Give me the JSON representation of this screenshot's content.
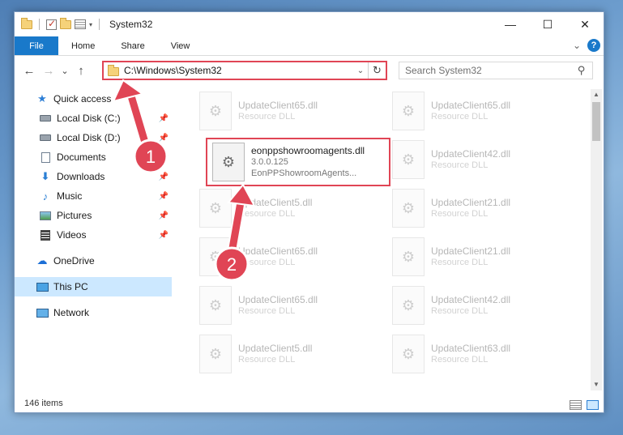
{
  "window": {
    "title": "System32",
    "controls": {
      "minimize": "—",
      "maximize": "☐",
      "close": "✕"
    }
  },
  "ribbon": {
    "tabs": [
      "File",
      "Home",
      "Share",
      "View"
    ],
    "expand": "⌄",
    "help": "?"
  },
  "nav": {
    "back": "←",
    "forward": "→",
    "recent": "⌄",
    "up": "↑",
    "address": "C:\\Windows\\System32",
    "address_dropdown": "⌄",
    "refresh": "↻",
    "search_placeholder": "Search System32",
    "search_icon": "⚲"
  },
  "sidebar": {
    "pin": "📌",
    "items": [
      {
        "label": "Quick access",
        "icon": "star-icon"
      },
      {
        "label": "Local Disk (C:)",
        "icon": "drive-icon",
        "pinned": true
      },
      {
        "label": "Local Disk (D:)",
        "icon": "drive-icon",
        "pinned": true
      },
      {
        "label": "Documents",
        "icon": "document-icon",
        "pinned": true
      },
      {
        "label": "Downloads",
        "icon": "download-icon",
        "pinned": true
      },
      {
        "label": "Music",
        "icon": "music-icon",
        "pinned": true
      },
      {
        "label": "Pictures",
        "icon": "pictures-icon",
        "pinned": true
      },
      {
        "label": "Videos",
        "icon": "videos-icon",
        "pinned": true
      },
      {
        "label": "OneDrive",
        "icon": "cloud-icon"
      },
      {
        "label": "This PC",
        "icon": "computer-icon",
        "selected": true
      },
      {
        "label": "Network",
        "icon": "network-icon"
      }
    ]
  },
  "files": {
    "left": [
      {
        "name": "UpdateClient65.dll",
        "type": "Resource DLL"
      },
      {
        "name": "UpdateClient5.dll",
        "type": "Resource DLL"
      },
      {
        "name": "UpdateClient65.dll",
        "type": "Resource DLL"
      },
      {
        "name": "UpdateClient65.dll",
        "type": "Resource DLL"
      },
      {
        "name": "UpdateClient5.dll",
        "type": "Resource DLL"
      }
    ],
    "right": [
      {
        "name": "UpdateClient65.dll",
        "type": "Resource DLL"
      },
      {
        "name": "UpdateClient42.dll",
        "type": "Resource DLL"
      },
      {
        "name": "UpdateClient21.dll",
        "type": "Resource DLL"
      },
      {
        "name": "UpdateClient21.dll",
        "type": "Resource DLL"
      },
      {
        "name": "UpdateClient42.dll",
        "type": "Resource DLL"
      },
      {
        "name": "UpdateClient63.dll",
        "type": "Resource DLL"
      }
    ],
    "highlighted": {
      "name": "eonppshowroomagents.dll",
      "version": "3.0.0.125",
      "description": "EonPPShowroomAgents..."
    }
  },
  "status": {
    "count": "146 items"
  },
  "annotations": {
    "step1": "1",
    "step2": "2",
    "color": "#e04555"
  }
}
